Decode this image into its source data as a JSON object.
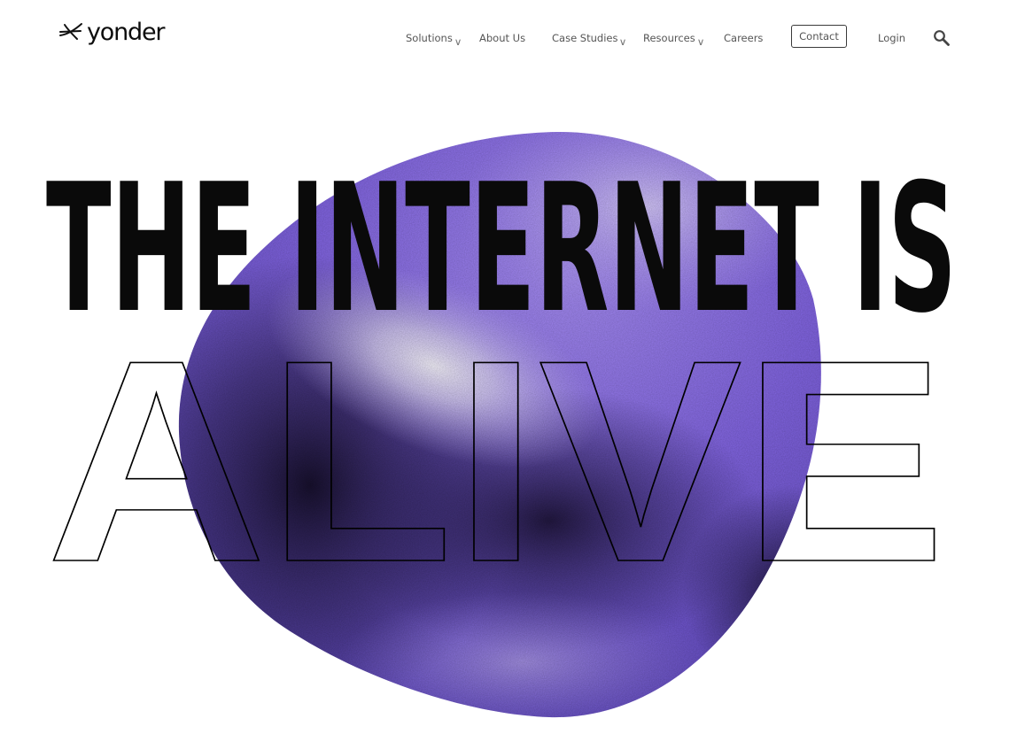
{
  "brand": {
    "name": "yonder"
  },
  "nav": {
    "items": [
      {
        "label": "Solutions",
        "has_dropdown": true
      },
      {
        "label": "About Us",
        "has_dropdown": false
      },
      {
        "label": "Case Studies",
        "has_dropdown": true
      },
      {
        "label": "Resources",
        "has_dropdown": true
      },
      {
        "label": "Careers",
        "has_dropdown": false
      }
    ],
    "dropdown_glyph": "∨",
    "contact_label": "Contact",
    "login_label": "Login",
    "search_icon": "search-icon"
  },
  "hero": {
    "line1": "THE INTERNET IS",
    "line2": "ALIVE",
    "blob_colors": {
      "base": "#7b5fe0",
      "highlight": "#e9e4f7",
      "shadow": "#1b1430",
      "light": "#a98cf5"
    }
  },
  "colors": {
    "text_dark": "#0d0d0d",
    "nav_text": "#555555",
    "background": "#ffffff"
  }
}
